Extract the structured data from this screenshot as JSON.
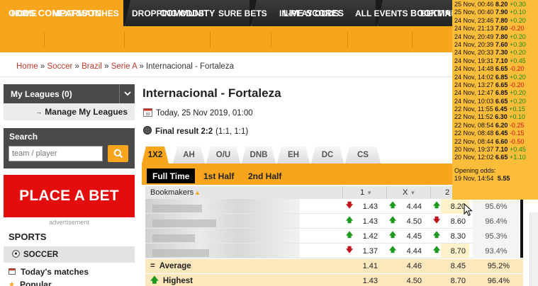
{
  "top_tabs": [
    {
      "label": "ODDS COMPARISON"
    },
    {
      "label": "COMMUNITY"
    },
    {
      "label": "LIVE SCORES"
    },
    {
      "label": "BOOKMAKERS"
    }
  ],
  "nav": [
    "HOME",
    "NEXT MATCHES",
    "DROPPING ODDS",
    "SURE BETS",
    "IN-PLAY ODDS",
    "ALL EVENTS",
    "BETTING"
  ],
  "breadcrumb": {
    "items": [
      "Home",
      "Soccer",
      "Brazil",
      "Serie A"
    ],
    "current": "Internacional - Fortaleza",
    "sep": "»"
  },
  "sidebar": {
    "my_leagues": "My Leagues (0)",
    "manage": "Manage My Leagues",
    "search_title": "Search",
    "search_placeholder": "team / player",
    "place_bet": "PLACE A BET",
    "advertisement": "advertisement",
    "sports_title": "SPORTS",
    "soccer": "SOCCER",
    "todays_matches": "Today's matches",
    "popular": "Popular"
  },
  "match": {
    "title": "Internacional - Fortaleza",
    "date": "Today, 25 Nov 2019, 01:00",
    "result_label": "Final result 2:2",
    "result_detail": "(1:1, 1:1)"
  },
  "market_tabs": [
    "1X2",
    "AH",
    "O/U",
    "DNB",
    "EH",
    "DC",
    "CS"
  ],
  "period_tabs": [
    "Full Time",
    "1st Half",
    "2nd Half"
  ],
  "table": {
    "headers": {
      "bookmakers": "Bookmakers",
      "c1": "1",
      "cx": "X",
      "c2": "2"
    },
    "rows": [
      {
        "o1": "1.43",
        "a1": "dn",
        "ox": "4.44",
        "ax": "up",
        "o2": "8.20",
        "a2": "up",
        "payout": "95.6%"
      },
      {
        "o1": "1.43",
        "a1": "up",
        "ox": "4.50",
        "ax": "up",
        "o2": "8.60",
        "a2": "dn",
        "payout": "96.4%"
      },
      {
        "o1": "1.42",
        "a1": "up",
        "ox": "4.45",
        "ax": "up",
        "o2": "8.30",
        "a2": "up",
        "payout": "95.3%"
      },
      {
        "o1": "1.37",
        "a1": "dn",
        "ox": "4.44",
        "ax": "up",
        "o2": "8.70",
        "a2": "up",
        "payout": "93.4%"
      }
    ],
    "average": {
      "label": "Average",
      "o1": "1.41",
      "ox": "4.46",
      "o2": "8.45",
      "payout": "95.2%"
    },
    "highest": {
      "label": "Highest",
      "o1": "1.43",
      "ox": "4.50",
      "o2": "8.70",
      "payout": "96.4%"
    }
  },
  "tooltip": {
    "history": [
      {
        "date": "25 Nov, 00:46",
        "odd": "8.20",
        "change": "+0.30",
        "dir": "up"
      },
      {
        "date": "25 Nov, 00:40",
        "odd": "7.90",
        "change": "+0.10",
        "dir": "up"
      },
      {
        "date": "24 Nov, 23:46",
        "odd": "7.80",
        "change": "+0.20",
        "dir": "up"
      },
      {
        "date": "24 Nov, 21:13",
        "odd": "7.60",
        "change": "-0.20",
        "dir": "dn"
      },
      {
        "date": "24 Nov, 20:49",
        "odd": "7.80",
        "change": "+0.20",
        "dir": "up"
      },
      {
        "date": "24 Nov, 20:39",
        "odd": "7.60",
        "change": "+0.30",
        "dir": "up"
      },
      {
        "date": "24 Nov, 20:33",
        "odd": "7.30",
        "change": "+0.20",
        "dir": "up"
      },
      {
        "date": "24 Nov, 19:31",
        "odd": "7.10",
        "change": "+0.45",
        "dir": "up"
      },
      {
        "date": "24 Nov, 14:48",
        "odd": "6.65",
        "change": "-0.20",
        "dir": "dn"
      },
      {
        "date": "24 Nov, 14:02",
        "odd": "6.85",
        "change": "+0.20",
        "dir": "up"
      },
      {
        "date": "24 Nov, 13:27",
        "odd": "6.65",
        "change": "-0.20",
        "dir": "dn"
      },
      {
        "date": "24 Nov, 12:47",
        "odd": "6.85",
        "change": "+0.20",
        "dir": "up"
      },
      {
        "date": "24 Nov, 10:03",
        "odd": "6.65",
        "change": "+0.20",
        "dir": "up"
      },
      {
        "date": "22 Nov, 11:55",
        "odd": "6.45",
        "change": "+0.15",
        "dir": "up"
      },
      {
        "date": "22 Nov, 11:52",
        "odd": "6.30",
        "change": "+0.10",
        "dir": "up"
      },
      {
        "date": "22 Nov, 08:54",
        "odd": "6.20",
        "change": "-0.25",
        "dir": "dn"
      },
      {
        "date": "22 Nov, 08:48",
        "odd": "6.45",
        "change": "-0.15",
        "dir": "dn"
      },
      {
        "date": "22 Nov, 08:44",
        "odd": "6.60",
        "change": "-0.50",
        "dir": "dn"
      },
      {
        "date": "20 Nov, 19:37",
        "odd": "7.10",
        "change": "+0.45",
        "dir": "up"
      },
      {
        "date": "20 Nov, 12:02",
        "odd": "6.65",
        "change": "+1.10",
        "dir": "up"
      }
    ],
    "opening_label": "Opening odds:",
    "opening_date": "19 Nov, 14:54",
    "opening_odd": "5.55"
  },
  "colors": {
    "accent": "#f7a51c",
    "dark": "#1b1b1b",
    "bet_red": "#e40d0d",
    "up": "#1d9a1d",
    "down": "#c0141a"
  }
}
